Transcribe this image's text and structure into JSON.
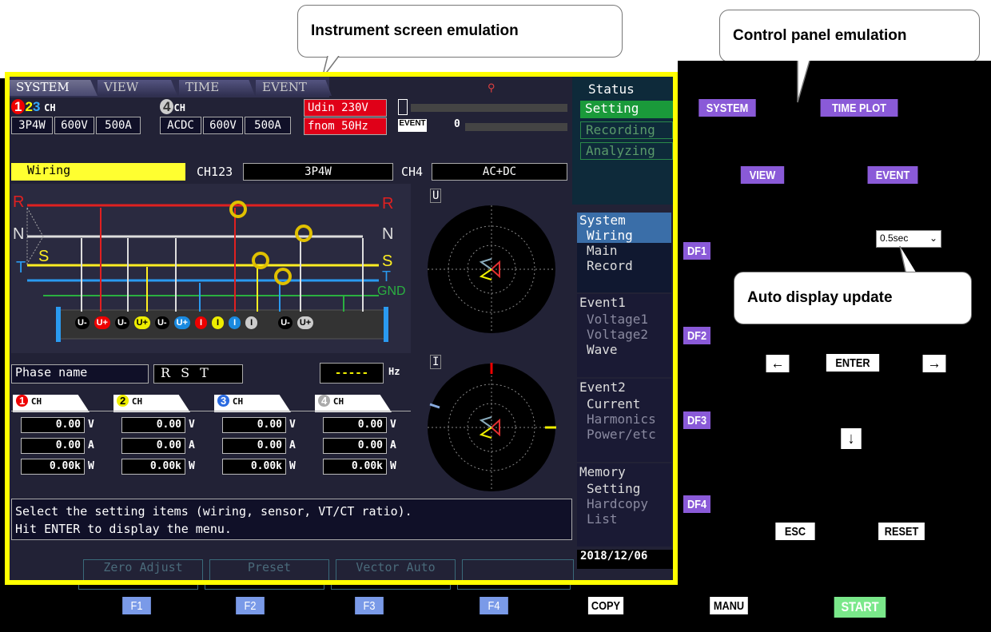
{
  "callouts": {
    "instrument": "Instrument screen emulation",
    "control": "Control panel emulation",
    "auto": "Auto display update"
  },
  "tabs": [
    "SYSTEM",
    "VIEW",
    "TIME PLOT",
    "EVENT"
  ],
  "ch123": {
    "label": "CH",
    "wiring": "3P4W",
    "voltage": "600V",
    "current": "500A"
  },
  "ch4": {
    "label": "CH",
    "mode": "ACDC",
    "voltage": "600V",
    "current": "500A"
  },
  "udin": "Udin 230V",
  "fnom": "fnom  50Hz",
  "event_badge": "EVENT",
  "event_count": "0",
  "status": {
    "title": "Status",
    "items": [
      "Setting",
      "Recording",
      "Analyzing"
    ]
  },
  "wiring_row": {
    "label": "Wiring",
    "ch123_label": "CH123",
    "ch123_value": "3P4W",
    "ch4_label": "CH4",
    "ch4_value": "AC+DC"
  },
  "diagram": {
    "R": "R",
    "N": "N",
    "S": "S",
    "T": "T",
    "GND": "GND",
    "jacks": [
      "U-",
      "U+",
      "U-",
      "U+",
      "U-",
      "U+",
      "I",
      "I",
      "I",
      "I",
      "U-",
      "U+"
    ]
  },
  "phasor": {
    "u": "U",
    "i": "I"
  },
  "phase_name": {
    "label": "Phase name",
    "value": "R S T"
  },
  "freq": {
    "value": "-----",
    "unit": "Hz"
  },
  "channels": [
    {
      "name": "CH",
      "v": "0.00",
      "a": "0.00",
      "w": "0.00k"
    },
    {
      "name": "CH",
      "v": "0.00",
      "a": "0.00",
      "w": "0.00k"
    },
    {
      "name": "CH",
      "v": "0.00",
      "a": "0.00",
      "w": "0.00k"
    },
    {
      "name": "CH",
      "v": "0.00",
      "a": "0.00",
      "w": "0.00k"
    }
  ],
  "units": {
    "v": "V",
    "a": "A",
    "w": "W"
  },
  "message": [
    "Select the setting items (wiring, sensor, VT/CT ratio).",
    "Hit ENTER to display the menu."
  ],
  "menu": {
    "system": {
      "title": "System",
      "items": [
        "Wiring",
        "Main",
        "Record"
      ]
    },
    "event1": {
      "title": "Event1",
      "items": [
        "Voltage1",
        "Voltage2",
        "Wave"
      ]
    },
    "event2": {
      "title": "Event2",
      "items": [
        "Current",
        "Harmonics",
        "Power/etc"
      ]
    },
    "memory": {
      "title": "Memory",
      "items": [
        "Setting",
        "Hardcopy",
        "List"
      ]
    }
  },
  "date": "2018/12/06",
  "bottom_tabs": [
    "Zero Adjust",
    "Preset",
    "Vector Auto",
    ""
  ],
  "control": {
    "system": "SYSTEM",
    "timeplot": "TIME PLOT",
    "view": "VIEW",
    "event": "EVENT",
    "df1": "DF1",
    "df2": "DF2",
    "df3": "DF3",
    "df4": "DF4",
    "update_select": "0.5sec",
    "left": "←",
    "enter": "ENTER",
    "right": "→",
    "down": "↓",
    "esc": "ESC",
    "reset": "RESET",
    "f1": "F1",
    "f2": "F2",
    "f3": "F3",
    "f4": "F4",
    "copy": "COPY",
    "manu": "MANU",
    "start": "START"
  }
}
